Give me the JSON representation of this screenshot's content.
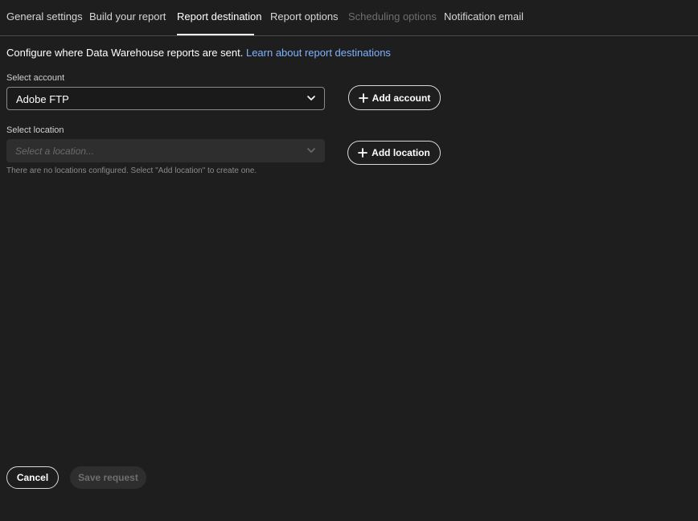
{
  "tabs": [
    {
      "label": "General settings",
      "state": "normal"
    },
    {
      "label": "Build your report",
      "state": "normal"
    },
    {
      "label": "Report destination",
      "state": "active"
    },
    {
      "label": "Report options",
      "state": "normal"
    },
    {
      "label": "Scheduling options",
      "state": "disabled"
    },
    {
      "label": "Notification email",
      "state": "normal"
    }
  ],
  "intro": {
    "text": "Configure where Data Warehouse reports are sent.",
    "link": "Learn about report destinations"
  },
  "account": {
    "label": "Select account",
    "value": "Adobe FTP",
    "add_button": "Add account"
  },
  "location": {
    "label": "Select location",
    "placeholder": "Select a location...",
    "add_button": "Add location",
    "helper": "There are no locations configured. Select \"Add location\" to create one."
  },
  "footer": {
    "cancel": "Cancel",
    "save": "Save request"
  },
  "icons": {
    "plus": "plus-icon",
    "chevron": "chevron-down-icon"
  },
  "colors": {
    "background": "#1e1e1e",
    "link": "#7fb3ff",
    "text": "#ffffff",
    "disabled": "#6e6e6e"
  }
}
